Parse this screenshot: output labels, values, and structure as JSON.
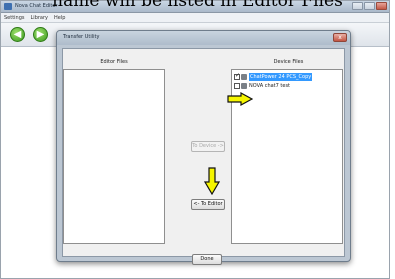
{
  "caption": "name will be listed in Editor Files",
  "app": {
    "title": "Nova Chat Editor",
    "menu": [
      "Settings",
      "Library",
      "Help"
    ]
  },
  "dialog": {
    "title": "Transfer Utility",
    "close_label": "x",
    "editor_files_header": "Editor Files",
    "device_files_header": "Device Files",
    "editor_files": [],
    "device_files": [
      {
        "name": "ChatPower 24 PCS_Copy",
        "checked": true,
        "selected": true
      },
      {
        "name": "NOVA chat7 test",
        "checked": false,
        "selected": false
      }
    ],
    "to_device_label": "To Device ->",
    "to_editor_label": "<- To Editor",
    "done_label": "Done"
  },
  "colors": {
    "annotation_arrow": "#f5f500",
    "selection": "#3399ff"
  },
  "icons": [
    "back-arrow-icon",
    "forward-arrow-icon",
    "checkbox-icon",
    "file-icon"
  ]
}
